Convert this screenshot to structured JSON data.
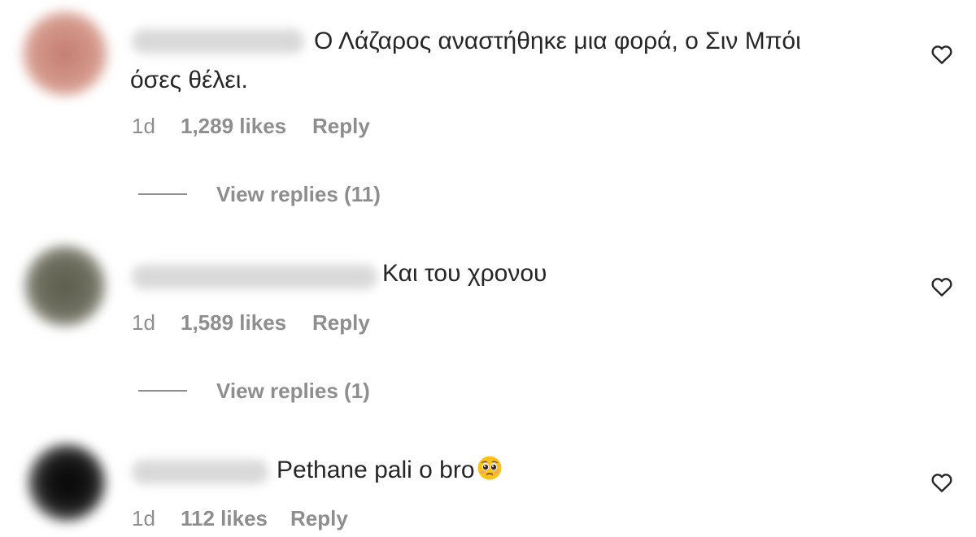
{
  "comments": [
    {
      "text_line1": "Ο Λάζαρος αναστήθηκε μια φορά, ο Σιν Μπόι",
      "text_line2": "όσες θέλει.",
      "time": "1d",
      "likes": "1,289 likes",
      "reply": "Reply",
      "view_replies": "View replies (11)",
      "avatar_color": "#c98a7e"
    },
    {
      "text_line1": "Και του χρονου",
      "time": "1d",
      "likes": "1,589 likes",
      "reply": "Reply",
      "view_replies": "View replies (1)",
      "avatar_color": "#6e6e5e"
    },
    {
      "text_line1": "Pethane pali o bro",
      "emoji": "pleading-face-emoji",
      "time": "1d",
      "likes": "112 likes",
      "reply": "Reply",
      "avatar_color": "#1a1a1a"
    }
  ],
  "icons": {
    "like": "heart-outline-icon"
  },
  "colors": {
    "text": "#262626",
    "secondary": "#8e8e8e",
    "background": "#ffffff"
  }
}
